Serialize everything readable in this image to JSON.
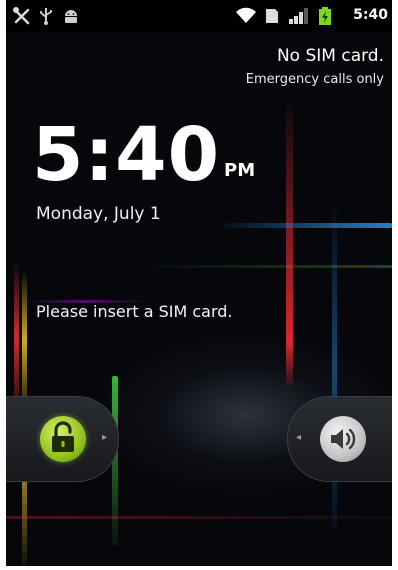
{
  "status_bar": {
    "time": "5:40",
    "left_icons": [
      "tools-icon",
      "usb-icon",
      "android-debug-icon"
    ],
    "right_icons": [
      "wifi-icon",
      "no-sim-icon",
      "signal-icon",
      "battery-icon"
    ]
  },
  "carrier": {
    "status": "No SIM card.",
    "emergency": "Emergency calls only"
  },
  "clock": {
    "time": "5:40",
    "ampm": "PM",
    "date": "Monday, July 1"
  },
  "message": "Please insert a SIM card.",
  "slider": {
    "left_tab_icon": "unlock-icon",
    "right_tab_icon": "sound-icon"
  },
  "colors": {
    "unlock_accent": "#93c21d",
    "battery": "#7fd81d",
    "background": "#06070b"
  }
}
